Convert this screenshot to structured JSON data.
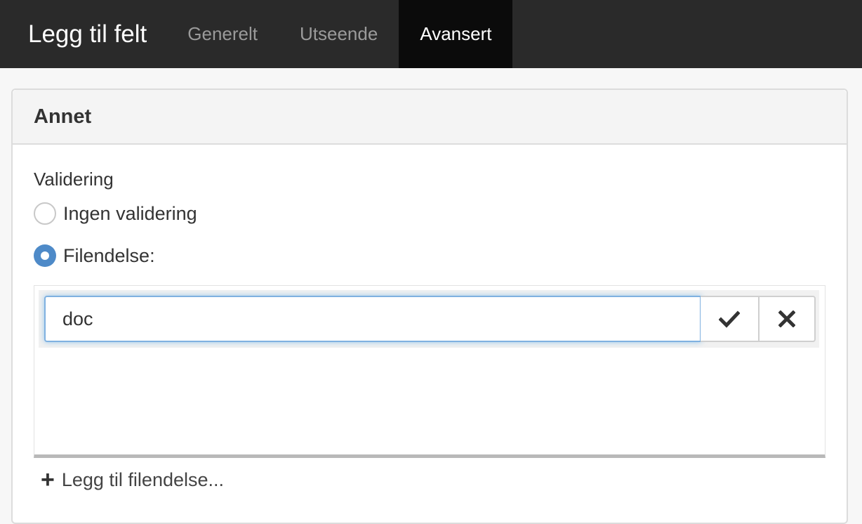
{
  "header": {
    "title": "Legg til felt",
    "tabs": [
      {
        "label": "Generelt",
        "active": false
      },
      {
        "label": "Utseende",
        "active": false
      },
      {
        "label": "Avansert",
        "active": true
      }
    ]
  },
  "panel": {
    "title": "Annet",
    "validation_label": "Validering",
    "options": [
      {
        "label": "Ingen validering",
        "selected": false
      },
      {
        "label": "Filendelse:",
        "selected": true
      }
    ],
    "extension_input": {
      "value": "doc"
    },
    "confirm_icon": "check-icon",
    "cancel_icon": "close-icon",
    "add_label": "Legg til filendelse..."
  },
  "colors": {
    "topbar": "#2a2a2a",
    "active_tab": "#0b0b0b",
    "radio_checked": "#4e8ac8",
    "input_focus": "#7fb1e0"
  }
}
